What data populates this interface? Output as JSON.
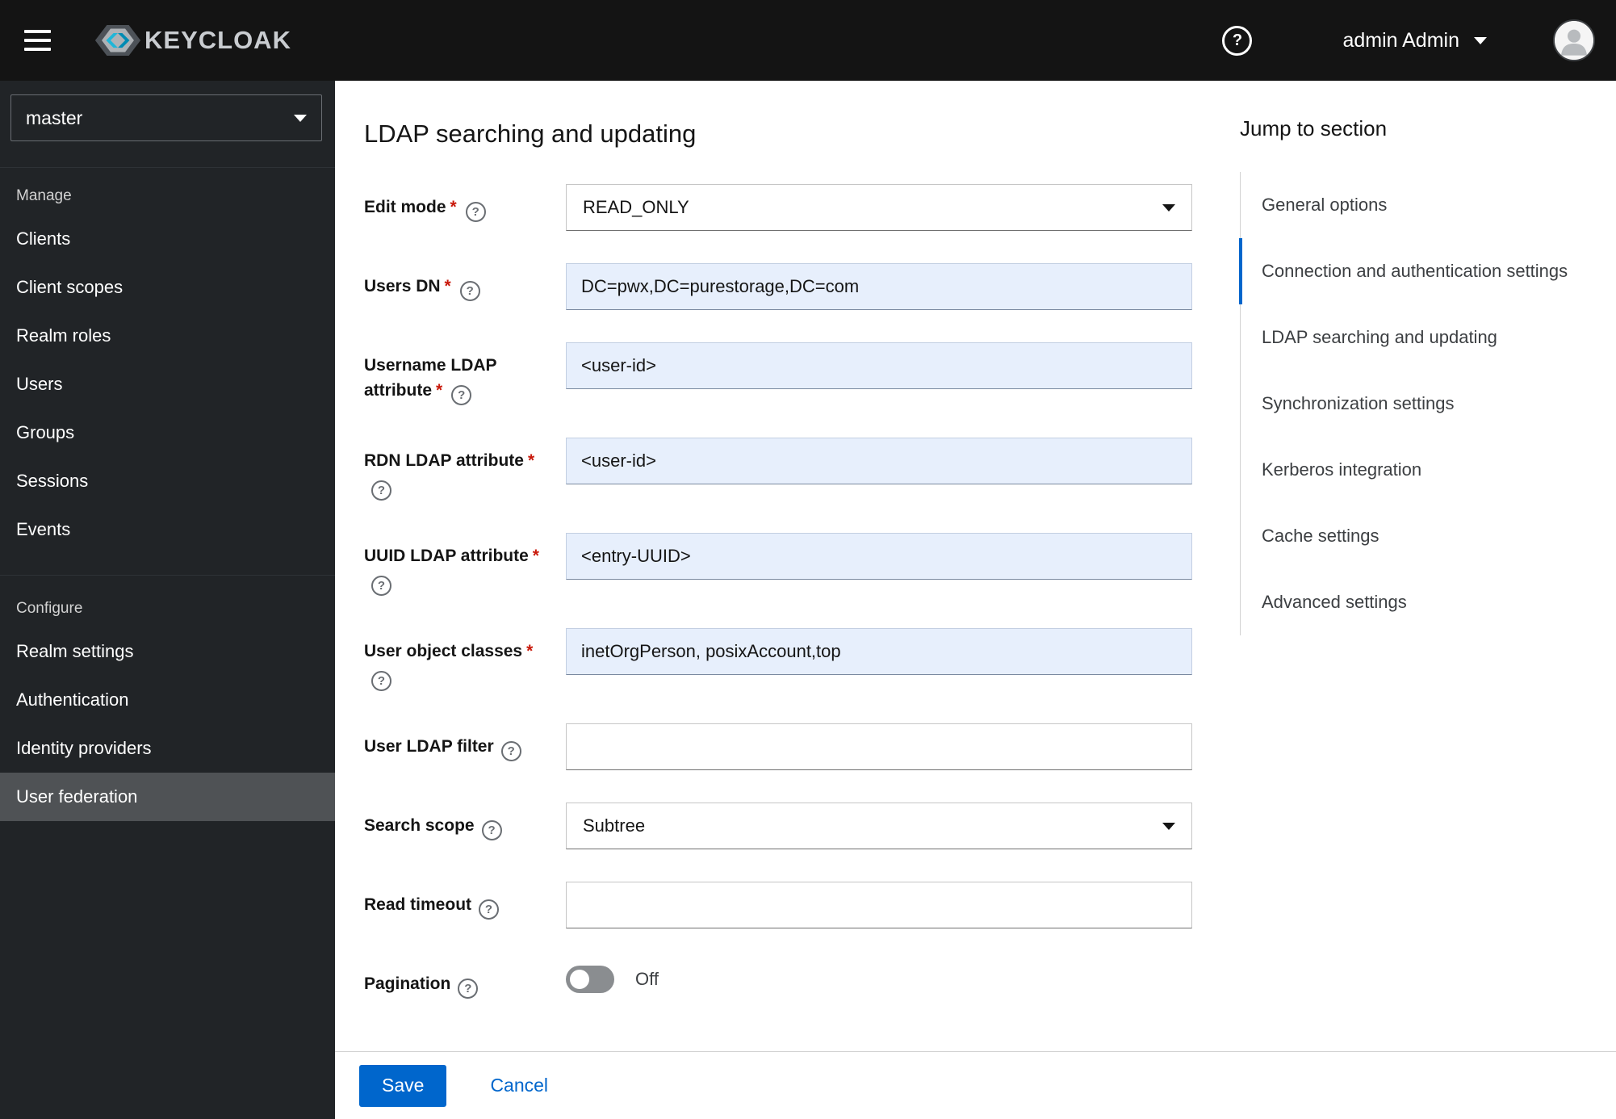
{
  "masthead": {
    "brand": "KEYCLOAK",
    "user": "admin Admin"
  },
  "sidebar": {
    "realm": "master",
    "manage": {
      "label": "Manage",
      "items": [
        "Clients",
        "Client scopes",
        "Realm roles",
        "Users",
        "Groups",
        "Sessions",
        "Events"
      ]
    },
    "configure": {
      "label": "Configure",
      "items": [
        "Realm settings",
        "Authentication",
        "Identity providers",
        "User federation"
      ]
    },
    "selected_item": "User federation"
  },
  "page": {
    "title": "LDAP searching and updating"
  },
  "form": {
    "required_marker": "*",
    "fields": [
      {
        "label": "Edit mode",
        "required": true,
        "type": "select",
        "value": "READ_ONLY"
      },
      {
        "label": "Users DN",
        "required": true,
        "type": "text",
        "value": "DC=pwx,DC=purestorage,DC=com"
      },
      {
        "label": "Username LDAP attribute",
        "required": true,
        "type": "text",
        "value": "<user-id>"
      },
      {
        "label": "RDN LDAP attribute",
        "required": true,
        "type": "text",
        "value": "<user-id>"
      },
      {
        "label": "UUID LDAP attribute",
        "required": true,
        "type": "text",
        "value": "<entry-UUID>"
      },
      {
        "label": "User object classes",
        "required": true,
        "type": "text",
        "value": "inetOrgPerson, posixAccount,top"
      },
      {
        "label": "User LDAP filter",
        "required": false,
        "type": "text",
        "value": ""
      },
      {
        "label": "Search scope",
        "required": false,
        "type": "select",
        "value": "Subtree"
      },
      {
        "label": "Read timeout",
        "required": false,
        "type": "text",
        "value": ""
      },
      {
        "label": "Pagination",
        "required": false,
        "type": "toggle",
        "value": "Off"
      }
    ]
  },
  "jump": {
    "title": "Jump to section",
    "items": [
      "General options",
      "Connection and authentication settings",
      "LDAP searching and updating",
      "Synchronization settings",
      "Kerberos integration",
      "Cache settings",
      "Advanced settings"
    ],
    "active": "Connection and authentication settings"
  },
  "actions": {
    "save": "Save",
    "cancel": "Cancel"
  },
  "colors": {
    "accent": "#0066cc",
    "masthead_bg": "#141414",
    "sidebar_bg": "#212427",
    "input_filled_bg": "#e7effc",
    "danger": "#c9190b"
  }
}
